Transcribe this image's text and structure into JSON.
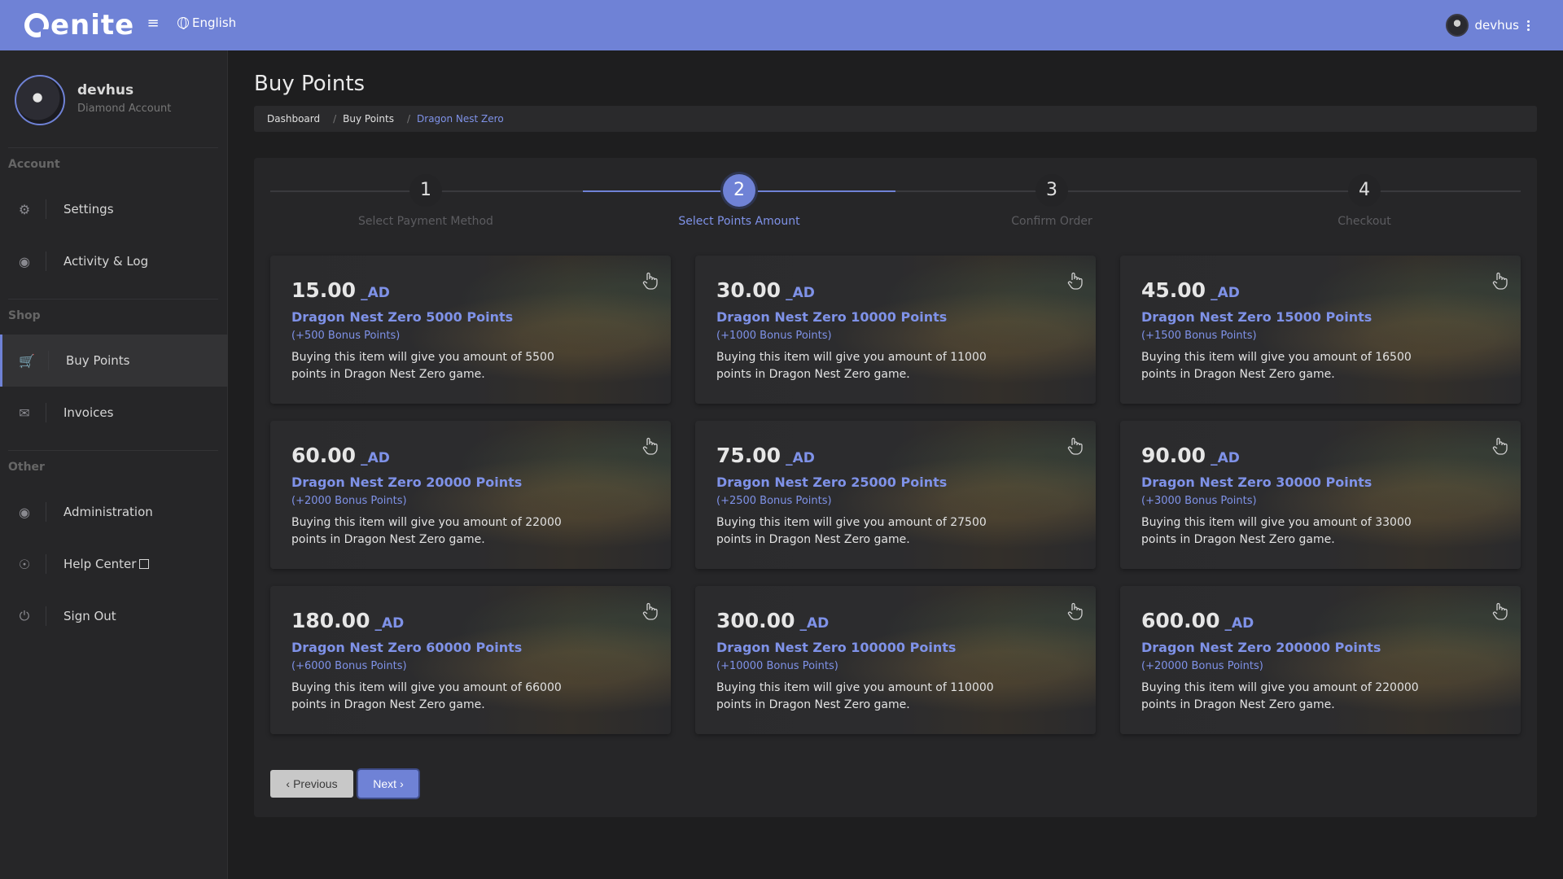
{
  "topbar": {
    "logo_text": "enite",
    "menu_icon": "hamburger-icon",
    "language": "English",
    "username": "devhus"
  },
  "sidebar": {
    "profile_name": "devhus",
    "profile_role": "Diamond Account",
    "sections": {
      "account": "Account",
      "shop": "Shop",
      "other": "Other"
    },
    "items": [
      {
        "label": "Settings",
        "icon": "gear-icon"
      },
      {
        "label": "Activity & Log",
        "icon": "eye-icon"
      },
      {
        "label": "Buy Points",
        "icon": "cart-icon",
        "active": true
      },
      {
        "label": "Invoices",
        "icon": "envelope-icon"
      },
      {
        "label": "Administration",
        "icon": "user-secret-icon"
      },
      {
        "label": "Help Center",
        "icon": "headset-icon"
      },
      {
        "label": "Sign Out",
        "icon": "power-icon"
      }
    ]
  },
  "main": {
    "title": "Buy Points",
    "breadcrumb": [
      "Dashboard",
      "Buy Points",
      "Dragon Nest Zero"
    ]
  },
  "stepper": {
    "steps": [
      {
        "num": "1",
        "label": "Select Payment Method"
      },
      {
        "num": "2",
        "label": "Select Points Amount",
        "active": true
      },
      {
        "num": "3",
        "label": "Confirm Order"
      },
      {
        "num": "4",
        "label": "Checkout"
      }
    ]
  },
  "packages": [
    {
      "price": "15.00",
      "currency": "_AD",
      "title": "Dragon Nest Zero 5000 Points",
      "bonus": "(+500 Bonus Points)",
      "desc": "Buying this item will give you amount of 5500 points in Dragon Nest Zero game."
    },
    {
      "price": "30.00",
      "currency": "_AD",
      "title": "Dragon Nest Zero 10000 Points",
      "bonus": "(+1000 Bonus Points)",
      "desc": "Buying this item will give you amount of 11000 points in Dragon Nest Zero game."
    },
    {
      "price": "45.00",
      "currency": "_AD",
      "title": "Dragon Nest Zero 15000 Points",
      "bonus": "(+1500 Bonus Points)",
      "desc": "Buying this item will give you amount of 16500 points in Dragon Nest Zero game."
    },
    {
      "price": "60.00",
      "currency": "_AD",
      "title": "Dragon Nest Zero 20000 Points",
      "bonus": "(+2000 Bonus Points)",
      "desc": "Buying this item will give you amount of 22000 points in Dragon Nest Zero game."
    },
    {
      "price": "75.00",
      "currency": "_AD",
      "title": "Dragon Nest Zero 25000 Points",
      "bonus": "(+2500 Bonus Points)",
      "desc": "Buying this item will give you amount of 27500 points in Dragon Nest Zero game."
    },
    {
      "price": "90.00",
      "currency": "_AD",
      "title": "Dragon Nest Zero 30000 Points",
      "bonus": "(+3000 Bonus Points)",
      "desc": "Buying this item will give you amount of 33000 points in Dragon Nest Zero game."
    },
    {
      "price": "180.00",
      "currency": "_AD",
      "title": "Dragon Nest Zero 60000 Points",
      "bonus": "(+6000 Bonus Points)",
      "desc": "Buying this item will give you amount of 66000 points in Dragon Nest Zero game."
    },
    {
      "price": "300.00",
      "currency": "_AD",
      "title": "Dragon Nest Zero 100000 Points",
      "bonus": "(+10000 Bonus Points)",
      "desc": "Buying this item will give you amount of 110000 points in Dragon Nest Zero game."
    },
    {
      "price": "600.00",
      "currency": "_AD",
      "title": "Dragon Nest Zero 200000 Points",
      "bonus": "(+20000 Bonus Points)",
      "desc": "Buying this item will give you amount of 220000 points in Dragon Nest Zero game."
    }
  ],
  "buttons": {
    "previous": "Previous",
    "next": "Next"
  },
  "colors": {
    "accent": "#6f82d6",
    "accent_text": "#7f92e8",
    "background": "#1e1e1f",
    "panel": "#262628"
  }
}
